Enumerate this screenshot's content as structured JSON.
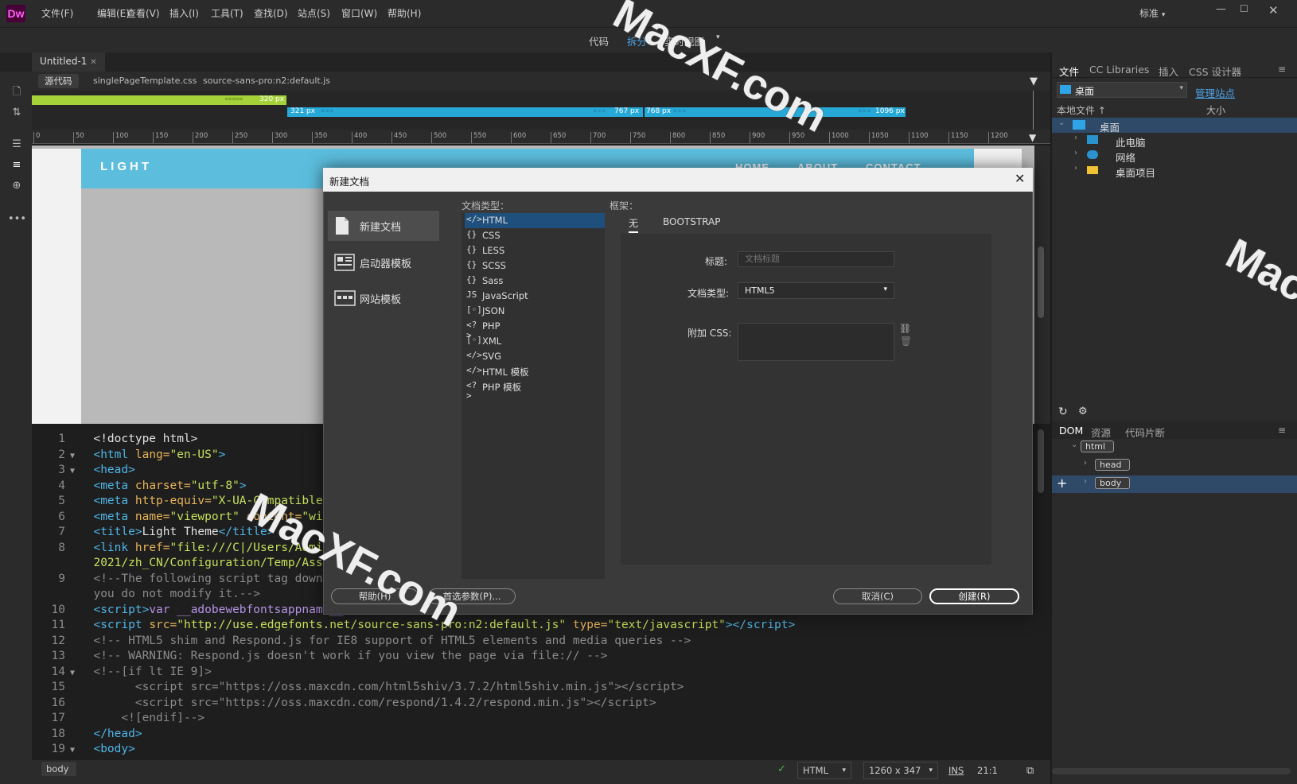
{
  "app": {
    "logo": "Dw",
    "workspace": "标准"
  },
  "menu": [
    "文件(F)",
    "编辑(E)",
    "查看(V)",
    "插入(I)",
    "工具(T)",
    "查找(D)",
    "站点(S)",
    "窗口(W)",
    "帮助(H)"
  ],
  "view_modes": {
    "code": "代码",
    "split": "拆分",
    "live": "实时视图",
    "active": "拆分"
  },
  "document": {
    "tab_title": "Untitled-1",
    "source_button": "源代码",
    "related_files": [
      "singlePageTemplate.css",
      "source-sans-pro:n2:default.js"
    ]
  },
  "media_queries": [
    {
      "label": "320 px"
    },
    {
      "label": "321 px"
    },
    {
      "label": "767 px"
    },
    {
      "label": "768 px"
    },
    {
      "label": "1096 px"
    }
  ],
  "ruler_ticks": [
    "0",
    "50",
    "100",
    "150",
    "200",
    "250",
    "300",
    "350",
    "400",
    "450",
    "500",
    "550",
    "600",
    "650",
    "700",
    "750",
    "800",
    "850",
    "900",
    "950",
    "1000",
    "1050",
    "1100",
    "1150",
    "1200"
  ],
  "live_page": {
    "logo": "LIGHT",
    "nav": [
      "HOME",
      "ABOUT",
      "CONTACT"
    ]
  },
  "code_lines": [
    {
      "n": "1",
      "fold": "",
      "html": "<span class='c-txt'>&lt;!doctype html&gt;</span>"
    },
    {
      "n": "2",
      "fold": "▼",
      "html": "<span class='c-tag'>&lt;html </span><span class='c-attr'>lang=</span><span class='c-val'>\"en-US\"</span><span class='c-tag'>&gt;</span>"
    },
    {
      "n": "3",
      "fold": "▼",
      "html": "<span class='c-tag'>&lt;head&gt;</span>"
    },
    {
      "n": "4",
      "fold": "",
      "html": "<span class='c-tag'>&lt;meta </span><span class='c-attr'>charset=</span><span class='c-val'>\"utf-8\"</span><span class='c-tag'>&gt;</span>"
    },
    {
      "n": "5",
      "fold": "",
      "html": "<span class='c-tag'>&lt;meta </span><span class='c-attr'>http-equiv=</span><span class='c-val'>\"X-UA-Compatible\"</span>"
    },
    {
      "n": "6",
      "fold": "",
      "html": "<span class='c-tag'>&lt;meta </span><span class='c-attr'>name=</span><span class='c-val'>\"viewport\"</span><span class='c-attr'> content=</span><span class='c-val'>\"wid</span>"
    },
    {
      "n": "7",
      "fold": "",
      "html": "<span class='c-tag'>&lt;title&gt;</span><span class='c-txt'>Light Theme</span><span class='c-tag'>&lt;/title&gt;</span>"
    },
    {
      "n": "8",
      "fold": "",
      "html": "<span class='c-tag'>&lt;link </span><span class='c-attr'>href=</span><span class='c-val'>\"file:///C|/Users/Admin</span>"
    },
    {
      "n": "",
      "fold": "",
      "html": "<span class='c-val'>2021/zh_CN/Configuration/Temp/Ass</span>"
    },
    {
      "n": "9",
      "fold": "",
      "html": "<span class='c-com'>&lt;!--The following script tag downl</span>"
    },
    {
      "n": "",
      "fold": "",
      "html": "<span class='c-com'>you do not modify it.--&gt;</span>"
    },
    {
      "n": "10",
      "fold": "",
      "html": "<span class='c-tag'>&lt;script&gt;</span><span class='c-var'>var __adobewebfontsappname__</span>"
    },
    {
      "n": "11",
      "fold": "",
      "html": "<span class='c-tag'>&lt;script </span><span class='c-attr'>src=</span><span class='c-val'>\"http://use.edgefonts.net/source-sans-pro:n2:default.js\"</span><span class='c-attr'> type=</span><span class='c-val'>\"text/javascript\"</span><span class='c-tag'>&gt;&lt;/script&gt;</span>"
    },
    {
      "n": "12",
      "fold": "",
      "html": "<span class='c-com'>&lt;!-- HTML5 shim and Respond.js for IE8 support of HTML5 elements and media queries --&gt;</span>"
    },
    {
      "n": "13",
      "fold": "",
      "html": "<span class='c-com'>&lt;!-- WARNING: Respond.js doesn't work if you view the page via file:// --&gt;</span>"
    },
    {
      "n": "14",
      "fold": "▼",
      "html": "<span class='c-com'>&lt;!--[if lt IE 9]&gt;</span>"
    },
    {
      "n": "15",
      "fold": "",
      "html": "<span class='c-com'>      &lt;script src=\"https://oss.maxcdn.com/html5shiv/3.7.2/html5shiv.min.js\"&gt;&lt;/script&gt;</span>"
    },
    {
      "n": "16",
      "fold": "",
      "html": "<span class='c-com'>      &lt;script src=\"https://oss.maxcdn.com/respond/1.4.2/respond.min.js\"&gt;&lt;/script&gt;</span>"
    },
    {
      "n": "17",
      "fold": "",
      "html": "<span class='c-com'>    &lt;![endif]--&gt;</span>"
    },
    {
      "n": "18",
      "fold": "",
      "html": "<span class='c-tag'>&lt;/head&gt;</span>"
    },
    {
      "n": "19",
      "fold": "▼",
      "html": "<span class='c-tag'>&lt;body&gt;</span>"
    }
  ],
  "status": {
    "tag": "body",
    "language": "HTML",
    "size": "1260 x 347",
    "mode": "INS",
    "position": "21:1"
  },
  "files_panel": {
    "tabs": [
      "文件",
      "CC Libraries",
      "插入",
      "CSS 设计器"
    ],
    "location": "桌面",
    "manage_link": "管理站点",
    "col_local": "本地文件 ↑",
    "col_size": "大小",
    "tree": [
      {
        "label": "桌面",
        "level": 0,
        "selected": true
      },
      {
        "label": "此电脑",
        "level": 1
      },
      {
        "label": "网络",
        "level": 1
      },
      {
        "label": "桌面项目",
        "level": 1
      }
    ]
  },
  "dom_panel": {
    "tabs": [
      "DOM",
      "资源",
      "代码片断"
    ],
    "nodes": [
      {
        "label": "html",
        "level": 0
      },
      {
        "label": "head",
        "level": 1
      },
      {
        "label": "body",
        "level": 1,
        "selected": true
      }
    ]
  },
  "dialog": {
    "title": "新建文档",
    "categories": [
      "新建文档",
      "启动器模板",
      "网站模板"
    ],
    "doc_type_label": "文档类型：",
    "framework_label": "框架：",
    "doc_types": [
      {
        "icon": "</>",
        "label": "HTML"
      },
      {
        "icon": "{}",
        "label": "CSS"
      },
      {
        "icon": "{}",
        "label": "LESS"
      },
      {
        "icon": "{}",
        "label": "SCSS"
      },
      {
        "icon": "{}",
        "label": "Sass"
      },
      {
        "icon": "JS",
        "label": "JavaScript"
      },
      {
        "icon": "[◦]",
        "label": "JSON"
      },
      {
        "icon": "<?>",
        "label": "PHP"
      },
      {
        "icon": "[◦]",
        "label": "XML"
      },
      {
        "icon": "</>",
        "label": "SVG"
      },
      {
        "icon": "</>",
        "label": "HTML 模板"
      },
      {
        "icon": "<?>",
        "label": "PHP 模板"
      }
    ],
    "framework_tabs": [
      "无",
      "BOOTSTRAP"
    ],
    "title_label": "标题:",
    "title_placeholder": "文档标题",
    "doctype_label": "文档类型:",
    "doctype_value": "HTML5",
    "css_label": "附加 CSS:",
    "buttons": {
      "help": "帮助(H)",
      "prefs": "首选参数(P)...",
      "cancel": "取消(C)",
      "create": "创建(R)"
    }
  },
  "watermark": "MacXF.com"
}
